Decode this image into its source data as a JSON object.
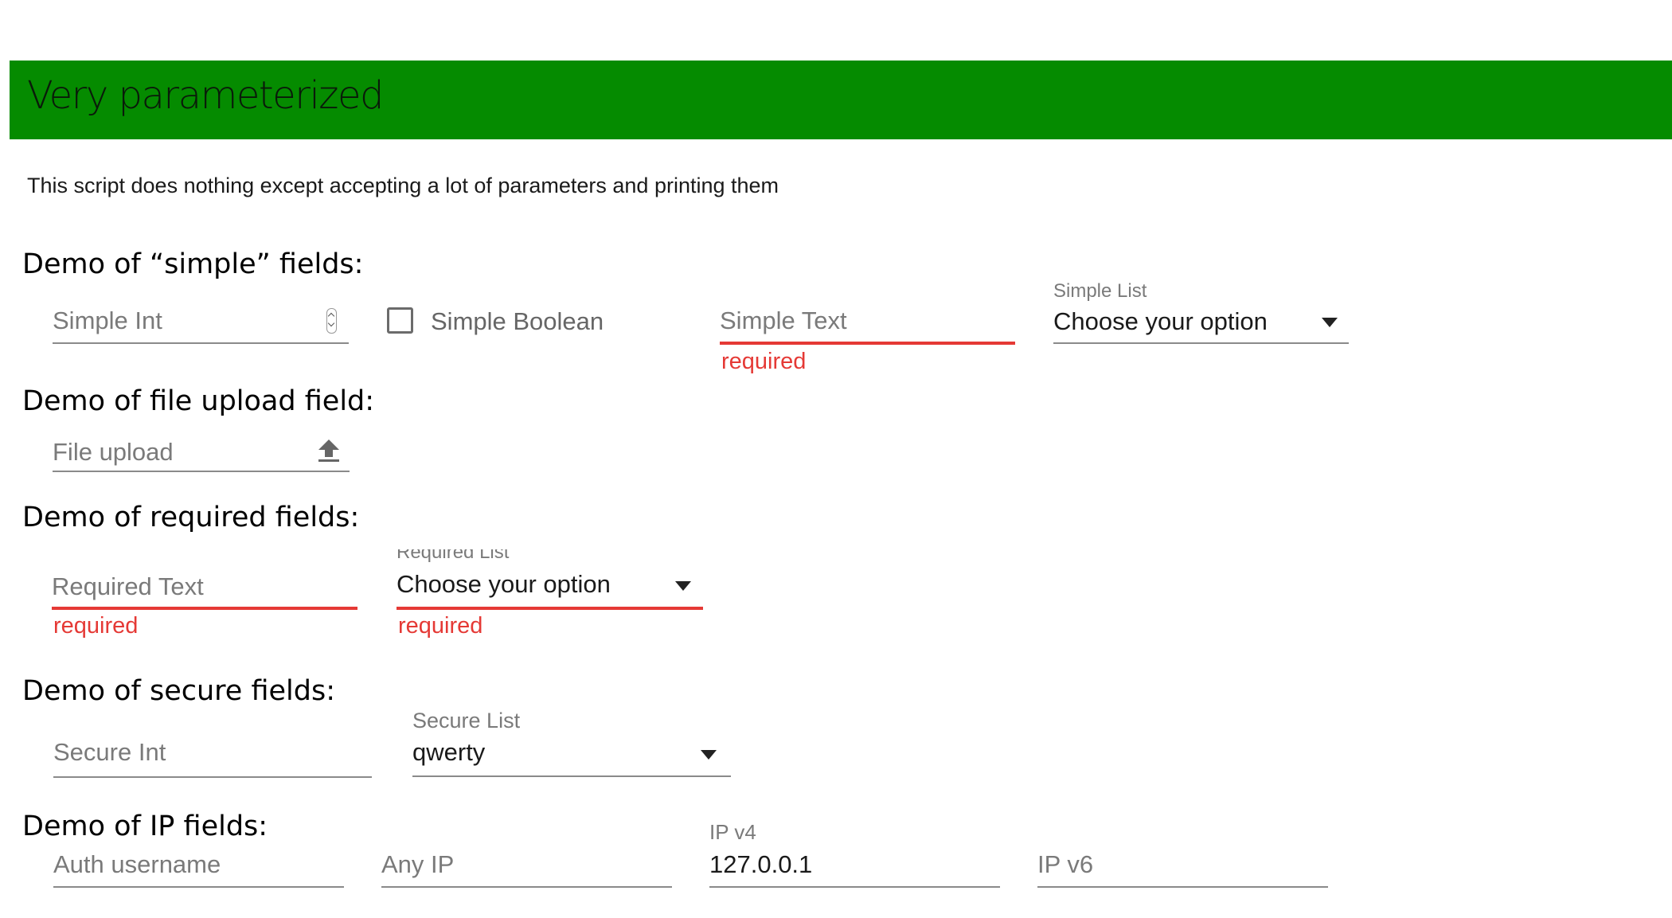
{
  "header": {
    "title": "Very parameterized",
    "color": "#058b00"
  },
  "description": "This script does nothing except accepting a lot of parameters and printing them",
  "sections": {
    "simple": "Demo of “simple” fields:",
    "file_upload": "Demo of file upload field:",
    "required": "Demo of required fields:",
    "secure": "Demo of secure fields:",
    "ip": "Demo of IP fields:"
  },
  "fields": {
    "simple_int": {
      "placeholder": "Simple Int"
    },
    "simple_boolean": {
      "label": "Simple Boolean",
      "checked": false
    },
    "simple_text": {
      "placeholder": "Simple Text",
      "error": "required"
    },
    "simple_list": {
      "label": "Simple List",
      "value": "Choose your option"
    },
    "file_upload": {
      "placeholder": "File upload",
      "icon": "upload-arrow-icon"
    },
    "required_text": {
      "placeholder": "Required Text",
      "error": "required"
    },
    "required_list": {
      "label": "Required List",
      "value": "Choose your option",
      "error": "required"
    },
    "secure_int": {
      "placeholder": "Secure Int"
    },
    "secure_list": {
      "label": "Secure List",
      "value": "qwerty"
    },
    "auth_username": {
      "placeholder": "Auth username"
    },
    "any_ip": {
      "placeholder": "Any IP"
    },
    "ip_v4": {
      "label": "IP v4",
      "value": "127.0.0.1"
    },
    "ip_v6": {
      "placeholder": "IP v6"
    }
  },
  "colors": {
    "error": "#e53935",
    "underline": "#8a8a8a"
  }
}
